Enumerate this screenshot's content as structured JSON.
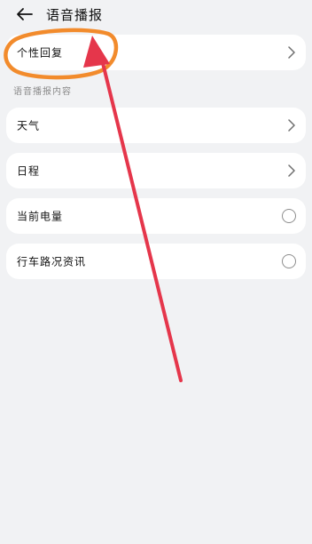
{
  "header": {
    "title": "语音播报",
    "back_icon": "arrow-left-icon"
  },
  "rows": {
    "personal_reply": "个性回复",
    "weather": "天气",
    "schedule": "日程",
    "battery": "当前电量",
    "traffic": "行车路况资讯"
  },
  "section": {
    "label": "语音播报内容"
  },
  "icons": {
    "chevron": "chevron-right-icon",
    "radio": "radio-button-icon"
  },
  "colors": {
    "background": "#f1f2f4",
    "card": "#ffffff",
    "annotation_circle": "#f28b2c",
    "annotation_arrow": "#e5364b"
  }
}
